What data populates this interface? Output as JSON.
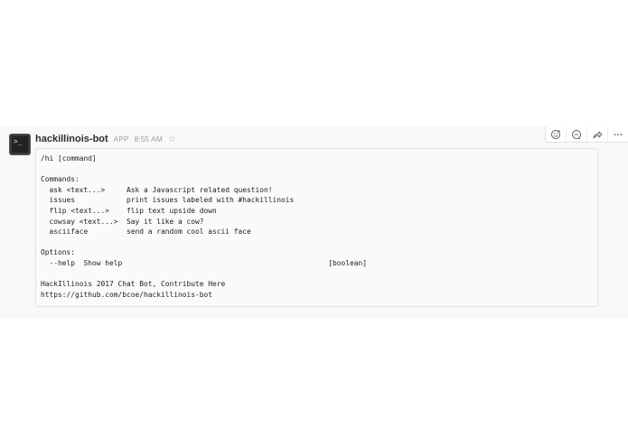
{
  "message": {
    "sender": "hackillinois-bot",
    "badge": "APP",
    "timestamp": "8:55 AM",
    "avatar_glyph": ">_",
    "body_lines": [
      "/hi [command]",
      "",
      "Commands:",
      "  ask <text...>     Ask a Javascript related question!",
      "  issues            print issues labeled with #hackillinois",
      "  flip <text...>    flip text upside down",
      "  cowsay <text...>  Say it like a cow?",
      "  asciiface         send a random cool ascii face",
      "",
      "Options:",
      "  --help  Show help                                                [boolean]",
      "",
      "HackIllinois 2017 Chat Bot, Contribute Here",
      "https://github.com/bcoe/hackillinois-bot"
    ]
  },
  "actions": {
    "icons": [
      "add-reaction-icon",
      "start-thread-icon",
      "share-icon",
      "more-actions-icon"
    ]
  },
  "colors": {
    "row_background": "#f9f9f9",
    "code_background": "#fbfaf8",
    "sender_text": "#2c2d30",
    "muted_text": "#a0a0a2"
  }
}
